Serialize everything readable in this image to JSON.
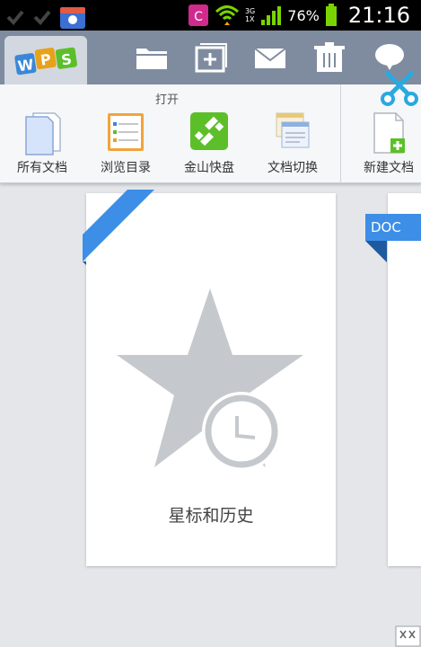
{
  "status_bar": {
    "battery": "76%",
    "time": "21:16",
    "network_top": "3G",
    "network_bottom": "1X",
    "app_badge": "C"
  },
  "toolbar": {
    "logo": "WPS"
  },
  "open_panel": {
    "title": "打开",
    "items": [
      {
        "label": "所有文档",
        "icon": "all-documents-icon"
      },
      {
        "label": "浏览目录",
        "icon": "browse-directory-icon"
      },
      {
        "label": "金山快盘",
        "icon": "kingsoft-kuaipan-icon"
      },
      {
        "label": "文档切换",
        "icon": "switch-documents-icon"
      }
    ],
    "new_document": {
      "label": "新建文档",
      "icon": "new-document-icon"
    }
  },
  "cards": [
    {
      "label": "星标和历史",
      "icon": "star-history-icon"
    },
    {
      "tag": "DOC"
    }
  ],
  "colors": {
    "accent": "#3d8ee6",
    "toolbar": "#7f8ca0",
    "green": "#5cbf2a"
  }
}
